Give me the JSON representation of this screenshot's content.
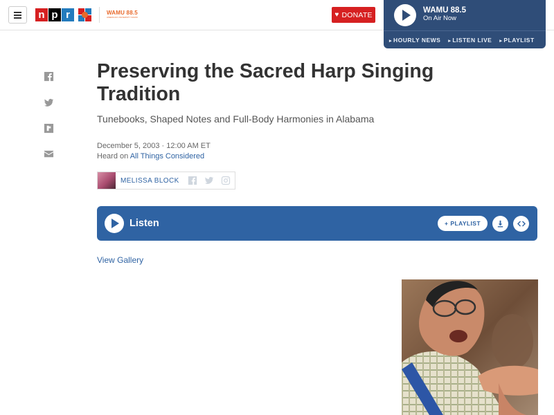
{
  "header": {
    "logo_letters": [
      "n",
      "p",
      "r"
    ],
    "station_logo_text": "WAMU 88.5",
    "station_logo_subtext": "AMERICAN UNIVERSITY RADIO",
    "donate_label": "DONATE",
    "station": {
      "name": "WAMU 88.5",
      "status": "On Air Now",
      "links": [
        "HOURLY NEWS",
        "LISTEN LIVE",
        "PLAYLIST"
      ]
    }
  },
  "share_icons": [
    "facebook-icon",
    "twitter-icon",
    "flipboard-icon",
    "email-icon"
  ],
  "article": {
    "title": "Preserving the Sacred Harp Singing Tradition",
    "subtitle": "Tunebooks, Shaped Notes and Full-Body Harmonies in Alabama",
    "dateline": "December 5, 2003 · 12:00 AM ET",
    "heard_prefix": "Heard on",
    "heard_program": "All Things Considered",
    "byline": {
      "name": "MELISSA BLOCK",
      "social_icons": [
        "facebook-icon",
        "twitter-icon",
        "instagram-icon"
      ]
    },
    "audio": {
      "label": "Listen",
      "playlist_label": "PLAYLIST"
    },
    "gallery_link": "View Gallery"
  },
  "colors": {
    "npr_red": "#d62021",
    "npr_blue": "#237bbd",
    "station_bg": "#2f4d78",
    "audio_bg": "#2f63a3",
    "link": "#2f63a3"
  }
}
